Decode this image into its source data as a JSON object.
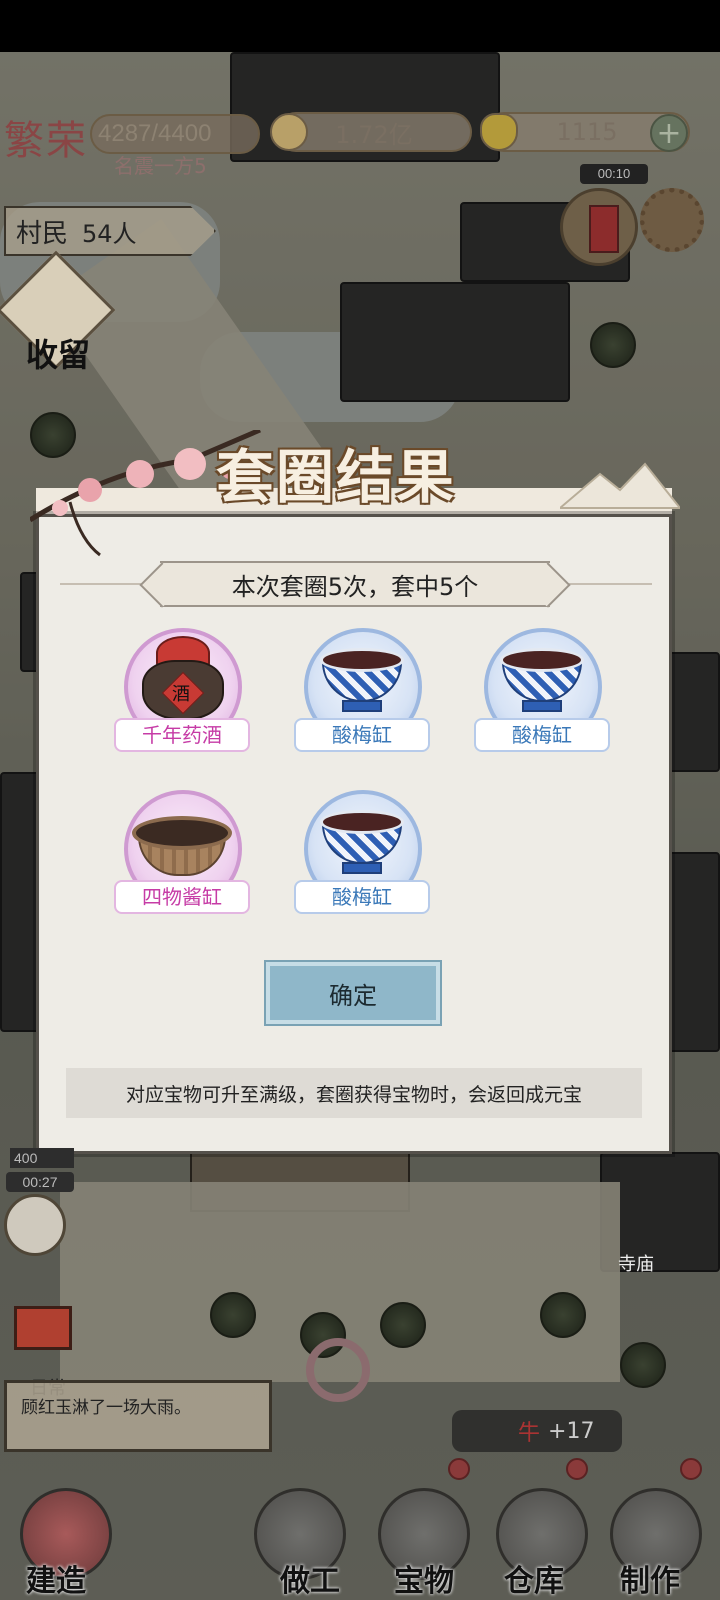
{
  "hud": {
    "prestige_logo": "繁荣",
    "prestige_value": "4287/4400",
    "prestige_title": "名震一方5",
    "coins": "1.72亿",
    "ingots": "1115",
    "plus_glyph": "+",
    "event_timer": "00:10",
    "villagers_label": "村民",
    "villagers_count": "54人",
    "shelter_label": "收留"
  },
  "dialog": {
    "title": "套圈结果",
    "summary": "本次套圈5次，套中5个",
    "items": [
      {
        "name": "千年药酒",
        "rarity": "purple",
        "icon": "medicine-wine-jar-icon"
      },
      {
        "name": "酸梅缸",
        "rarity": "blue",
        "icon": "blue-white-bowl-icon"
      },
      {
        "name": "酸梅缸",
        "rarity": "blue",
        "icon": "blue-white-bowl-icon"
      },
      {
        "name": "四物酱缸",
        "rarity": "purple",
        "icon": "sauce-pot-icon"
      },
      {
        "name": "酸梅缸",
        "rarity": "blue",
        "icon": "blue-white-bowl-icon"
      }
    ],
    "jar_label": "酒",
    "confirm_label": "确定",
    "note": "对应宝物可升至满级，套圈获得宝物时，会返回成元宝"
  },
  "bottom": {
    "badge_value": "400",
    "npc_timer": "00:27",
    "temple_sign": "寺庙",
    "daily_tag": "日常",
    "log_text": "顾红玉淋了一场大雨。",
    "ox_name": "牛",
    "ox_gain": "+17",
    "nav": [
      {
        "label": "建造"
      },
      {
        "label": "做工"
      },
      {
        "label": "宝物"
      },
      {
        "label": "仓库"
      },
      {
        "label": "制作"
      }
    ]
  },
  "colors": {
    "purple_rarity": "#c63ba6",
    "blue_rarity": "#3a78b8",
    "confirm_button": "#8fb7c9",
    "dialog_bg": "#eeece6"
  }
}
